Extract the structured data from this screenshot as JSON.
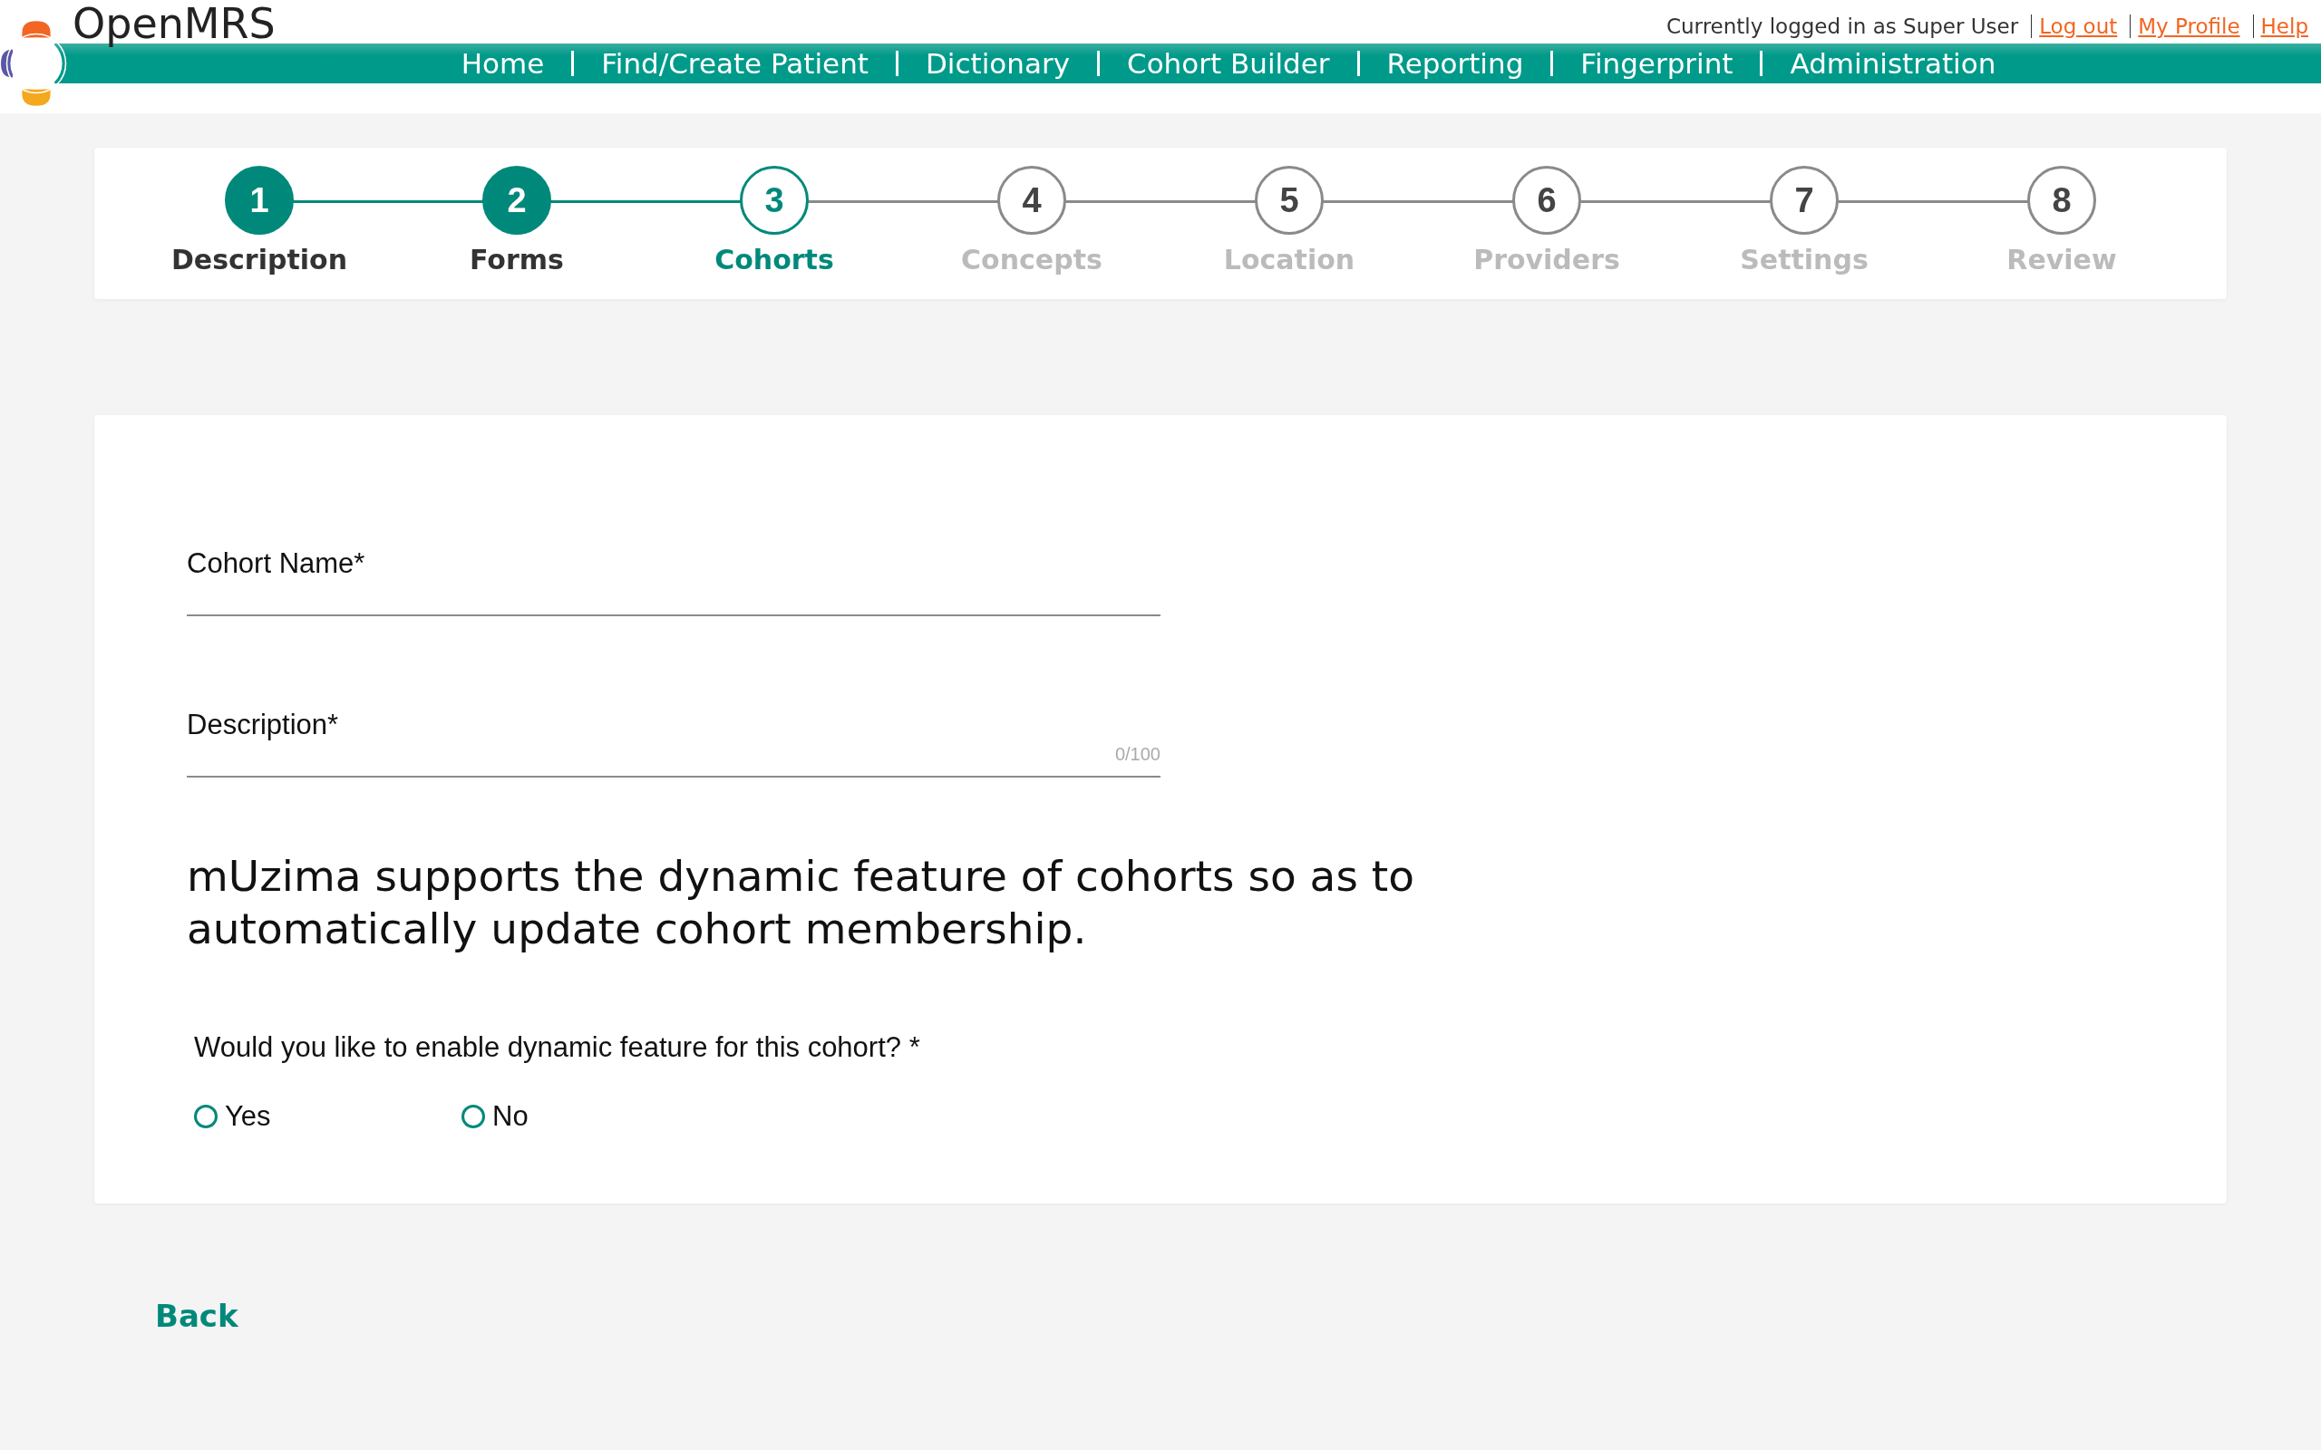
{
  "header": {
    "logo_text": "OpenMRS",
    "user_status": "Currently logged in as Super User",
    "user_links": [
      "Log out",
      "My Profile",
      "Help"
    ],
    "nav": [
      "Home",
      "Find/Create Patient",
      "Dictionary",
      "Cohort Builder",
      "Reporting",
      "Fingerprint",
      "Administration"
    ]
  },
  "stepper": [
    {
      "number": "1",
      "label": "Description",
      "completed": true,
      "selected": false
    },
    {
      "number": "2",
      "label": "Forms",
      "completed": true,
      "selected": false
    },
    {
      "number": "3",
      "label": "Cohorts",
      "completed": false,
      "selected": true
    },
    {
      "number": "4",
      "label": "Concepts",
      "completed": false,
      "selected": false
    },
    {
      "number": "5",
      "label": "Location",
      "completed": false,
      "selected": false
    },
    {
      "number": "6",
      "label": "Providers",
      "completed": false,
      "selected": false
    },
    {
      "number": "7",
      "label": "Settings",
      "completed": false,
      "selected": false
    },
    {
      "number": "8",
      "label": "Review",
      "completed": false,
      "selected": false
    }
  ],
  "form": {
    "fields": [
      {
        "label": "Cohort Name*"
      },
      {
        "label": "Description*",
        "counter": "0/100"
      }
    ],
    "info": "mUzima supports the dynamic feature of cohorts so as to automatically update cohort membership.",
    "question": "Would you like to enable dynamic feature for this cohort? *",
    "options": [
      {
        "label": "Yes",
        "selected": false
      },
      {
        "label": "No",
        "selected": false
      }
    ]
  },
  "back_link": "Back"
}
